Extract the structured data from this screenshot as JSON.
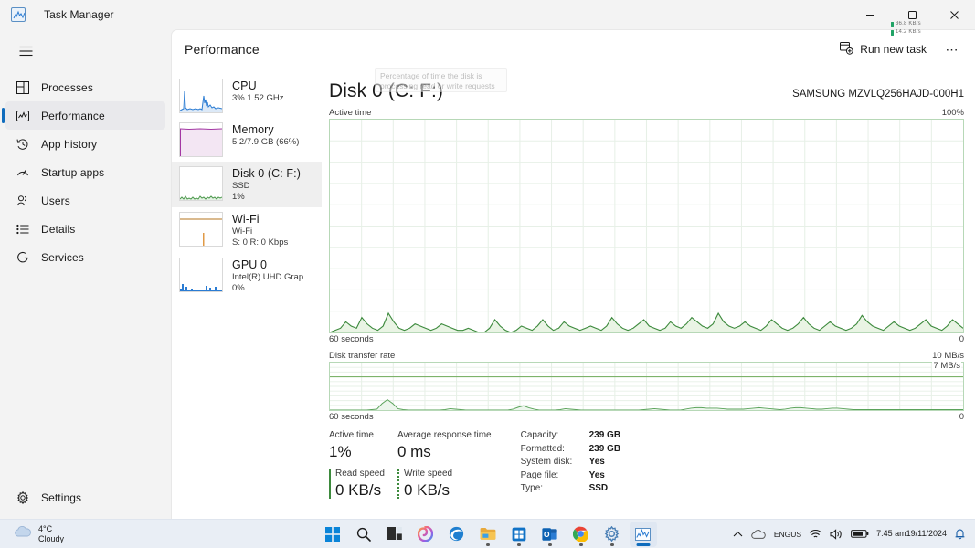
{
  "window": {
    "app_icon": "chart-icon",
    "title": "Task Manager",
    "minimize": "─",
    "maximize": "❐",
    "close": "✕"
  },
  "net_overlay": {
    "up": "36.8 KB/s",
    "down": "14.2 KB/s"
  },
  "sidebar": {
    "hamburger": "menu-icon",
    "items": [
      {
        "label": "Processes",
        "icon": "processes-icon",
        "active": false
      },
      {
        "label": "Performance",
        "icon": "performance-icon",
        "active": true
      },
      {
        "label": "App history",
        "icon": "history-icon",
        "active": false
      },
      {
        "label": "Startup apps",
        "icon": "startup-icon",
        "active": false
      },
      {
        "label": "Users",
        "icon": "users-icon",
        "active": false
      },
      {
        "label": "Details",
        "icon": "details-icon",
        "active": false
      },
      {
        "label": "Services",
        "icon": "services-icon",
        "active": false
      }
    ],
    "settings": {
      "label": "Settings",
      "icon": "gear-icon"
    }
  },
  "header": {
    "title": "Performance",
    "run_new_task": "Run new task",
    "more": "⋯"
  },
  "resources": [
    {
      "name": "CPU",
      "sub1": "3%  1.52 GHz",
      "sub2": "",
      "color": "#2b7cd3",
      "fill": "#dce9f7",
      "active": false,
      "shape": "cpu"
    },
    {
      "name": "Memory",
      "sub1": "5.2/7.9 GB (66%)",
      "sub2": "",
      "color": "#a337a3",
      "fill": "#f3e6f3",
      "active": false,
      "shape": "mem"
    },
    {
      "name": "Disk 0 (C: F:)",
      "sub1": "SSD",
      "sub2": "1%",
      "color": "#4e9a4e",
      "fill": "#e4f1e4",
      "active": true,
      "shape": "disk"
    },
    {
      "name": "Wi-Fi",
      "sub1": "Wi-Fi",
      "sub2": "S: 0 R: 0 Kbps",
      "color": "#b5761f",
      "fill": "#f7efe2",
      "active": false,
      "shape": "wifi"
    },
    {
      "name": "GPU 0",
      "sub1": "Intel(R) UHD Grap...",
      "sub2": "0%",
      "color": "#2b7cd3",
      "fill": "#dce9f7",
      "active": false,
      "shape": "gpu"
    }
  ],
  "detail": {
    "title": "Disk 0 (C: F:)",
    "model": "SAMSUNG MZVLQ256HAJD-000H1",
    "chart1": {
      "label": "Active time",
      "max": "100%",
      "time": "60 seconds",
      "min": "0"
    },
    "chart2": {
      "label": "Disk transfer rate",
      "max": "10 MB/s",
      "line_label": "7 MB/s",
      "time": "60 seconds",
      "min": "0"
    },
    "tooltip": "Percentage of time the disk is processing read or write requests",
    "stats": [
      {
        "label": "Active time",
        "value": "1%"
      },
      {
        "label": "Average response time",
        "value": "0 ms"
      }
    ],
    "speeds": [
      {
        "label": "Read speed",
        "value": "0 KB/s",
        "style": "solid"
      },
      {
        "label": "Write speed",
        "value": "0 KB/s",
        "style": "dashed"
      }
    ],
    "info": [
      {
        "key": "Capacity:",
        "value": "239 GB"
      },
      {
        "key": "Formatted:",
        "value": "239 GB"
      },
      {
        "key": "System disk:",
        "value": "Yes"
      },
      {
        "key": "Page file:",
        "value": "Yes"
      },
      {
        "key": "Type:",
        "value": "SSD"
      }
    ]
  },
  "chart_data": {
    "type": "area",
    "title": "Disk 0 (C: F:) - Active time / Disk transfer rate",
    "xlabel": "60 seconds",
    "charts": [
      {
        "name": "Active time",
        "ylabel": "Active time",
        "ylim": [
          0,
          100
        ],
        "y_max_label": "100%",
        "y_min_label": "0",
        "grid": true,
        "color": "#3d8a3d",
        "fill": "#e9f4e4",
        "values": [
          0,
          1,
          2,
          5,
          3,
          2,
          7,
          4,
          2,
          1,
          3,
          9,
          5,
          2,
          1,
          2,
          4,
          3,
          2,
          1,
          2,
          4,
          3,
          2,
          1,
          1,
          2,
          1,
          0,
          0,
          2,
          6,
          3,
          1,
          0,
          1,
          3,
          2,
          1,
          3,
          6,
          3,
          1,
          2,
          5,
          3,
          2,
          1,
          2,
          3,
          2,
          1,
          3,
          7,
          4,
          2,
          1,
          2,
          4,
          6,
          3,
          2,
          1,
          2,
          5,
          3,
          2,
          4,
          7,
          5,
          3,
          2,
          4,
          9,
          5,
          3,
          2,
          3,
          5,
          3,
          2,
          1,
          3,
          6,
          4,
          2,
          1,
          2,
          4,
          7,
          4,
          2,
          1,
          3,
          5,
          3,
          2,
          1,
          2,
          4,
          8,
          5,
          3,
          2,
          1,
          3,
          5,
          3,
          2,
          1,
          2,
          4,
          6,
          3,
          2,
          1,
          3,
          6,
          4,
          2
        ]
      },
      {
        "name": "Disk transfer rate",
        "ylabel": "Disk transfer rate",
        "ylim": [
          0,
          10
        ],
        "y_max_label": "10 MB/s",
        "y_min_label": "0",
        "reference_line": {
          "value": 7,
          "label": "7 MB/s"
        },
        "grid": true,
        "color": "#5aa35a",
        "fill": "#ecf6ec",
        "values": [
          0,
          0,
          0,
          0,
          0,
          0,
          0,
          0,
          0.1,
          0.2,
          1.4,
          2.2,
          1.4,
          0.3,
          0.1,
          0,
          0,
          0,
          0,
          0,
          0,
          0,
          0.1,
          0.3,
          0.2,
          0.1,
          0,
          0,
          0,
          0,
          0,
          0,
          0,
          0,
          0,
          0.2,
          0.6,
          0.9,
          0.5,
          0.2,
          0,
          0,
          0,
          0,
          0.1,
          0.3,
          0.2,
          0.1,
          0,
          0,
          0,
          0,
          0,
          0,
          0,
          0,
          0,
          0,
          0,
          0,
          0.1,
          0.2,
          0.3,
          0.2,
          0.1,
          0,
          0,
          0,
          0.2,
          0.4,
          0.5,
          0.5,
          0.4,
          0.4,
          0.4,
          0.3,
          0.2,
          0.2,
          0.2,
          0.2,
          0.3,
          0.4,
          0.5,
          0.4,
          0.3,
          0.2,
          0.1,
          0.2,
          0.4,
          0.5,
          0.5,
          0.4,
          0.3,
          0.2,
          0.2,
          0.3,
          0.4,
          0.4,
          0.3,
          0.2,
          0.1,
          0.1,
          0.1,
          0.1,
          0.1,
          0.1,
          0.1,
          0.1,
          0.1,
          0.1,
          0.1,
          0.1,
          0.1,
          0.1,
          0.1,
          0.1,
          0.1,
          0.1,
          0.1,
          0.1,
          0.1,
          0.1
        ]
      }
    ]
  },
  "taskbar": {
    "weather": {
      "temp": "4°C",
      "cond": "Cloudy",
      "icon": "cloud-icon"
    },
    "apps": [
      {
        "name": "start-button",
        "icon": "windows-logo"
      },
      {
        "name": "search-button",
        "icon": "search-icon"
      },
      {
        "name": "task-view-button",
        "icon": "task-view-icon"
      },
      {
        "name": "copilot-button",
        "icon": "copilot-icon"
      },
      {
        "name": "edge-button",
        "icon": "edge-icon"
      },
      {
        "name": "file-explorer-button",
        "icon": "folder-icon"
      },
      {
        "name": "microsoft-store-button",
        "icon": "store-icon"
      },
      {
        "name": "outlook-button",
        "icon": "outlook-icon"
      },
      {
        "name": "chrome-button",
        "icon": "chrome-icon"
      },
      {
        "name": "settings-button",
        "icon": "gear-icon"
      },
      {
        "name": "task-manager-button",
        "icon": "chart-icon"
      }
    ],
    "tray": {
      "chevron": "⌃",
      "cloud": "cloud-icon",
      "lang_line1": "ENG",
      "lang_line2": "US",
      "wifi": "wifi-icon",
      "volume": "volume-icon",
      "battery": "battery-icon",
      "time": "7:45 am",
      "date": "19/11/2024",
      "bell": "bell-icon"
    }
  }
}
